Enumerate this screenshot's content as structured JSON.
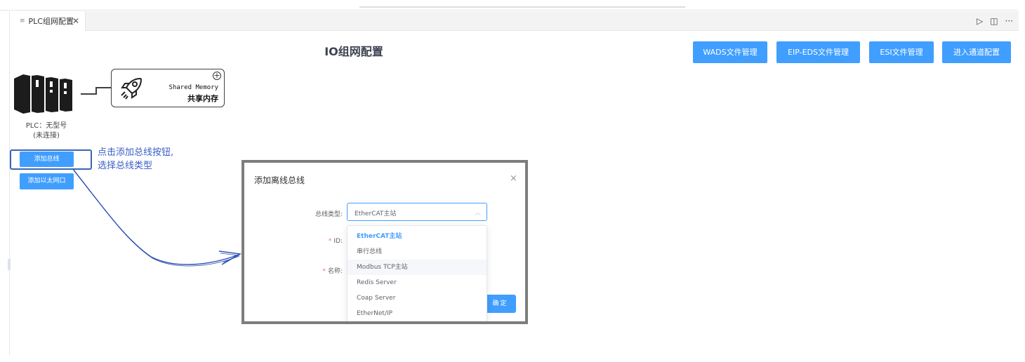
{
  "tab": {
    "title": "PLC组网配置",
    "close": "✕"
  },
  "tab_actions": {
    "run": "▷",
    "split": "◫",
    "more": "···"
  },
  "page_title": "IO组网配置",
  "header_buttons": [
    "WADS文件管理",
    "EIP-EDS文件管理",
    "ESI文件管理",
    "进入通道配置"
  ],
  "plc": {
    "label": "PLC：无型号",
    "status": "(未连接)"
  },
  "shared_memory": {
    "plus": "+",
    "title_en": "Shared Memory",
    "title_cn": "共享内存"
  },
  "side_buttons": {
    "add_bus": "添加总线",
    "add_ethernet": "添加以太网口"
  },
  "annotation": {
    "line1": "点击添加总线按钮,",
    "line2": "选择总线类型"
  },
  "dialog": {
    "title": "添加离线总线",
    "close": "×",
    "fields": {
      "bus_type": "总线类型:",
      "id": "ID:",
      "name": "名称:"
    },
    "required_mark": "*",
    "select": {
      "value": "EtherCAT主站",
      "arrow": "︿"
    },
    "options": [
      "EtherCAT主站",
      "串行总线",
      "Modbus TCP主站",
      "Redis Server",
      "Coap Server",
      "EtherNet/IP"
    ],
    "confirm": "确定"
  },
  "colors": {
    "primary": "#409eff",
    "annotation": "#3a5fc4",
    "frame": "#7d7d7d",
    "required": "#f56c6c"
  }
}
